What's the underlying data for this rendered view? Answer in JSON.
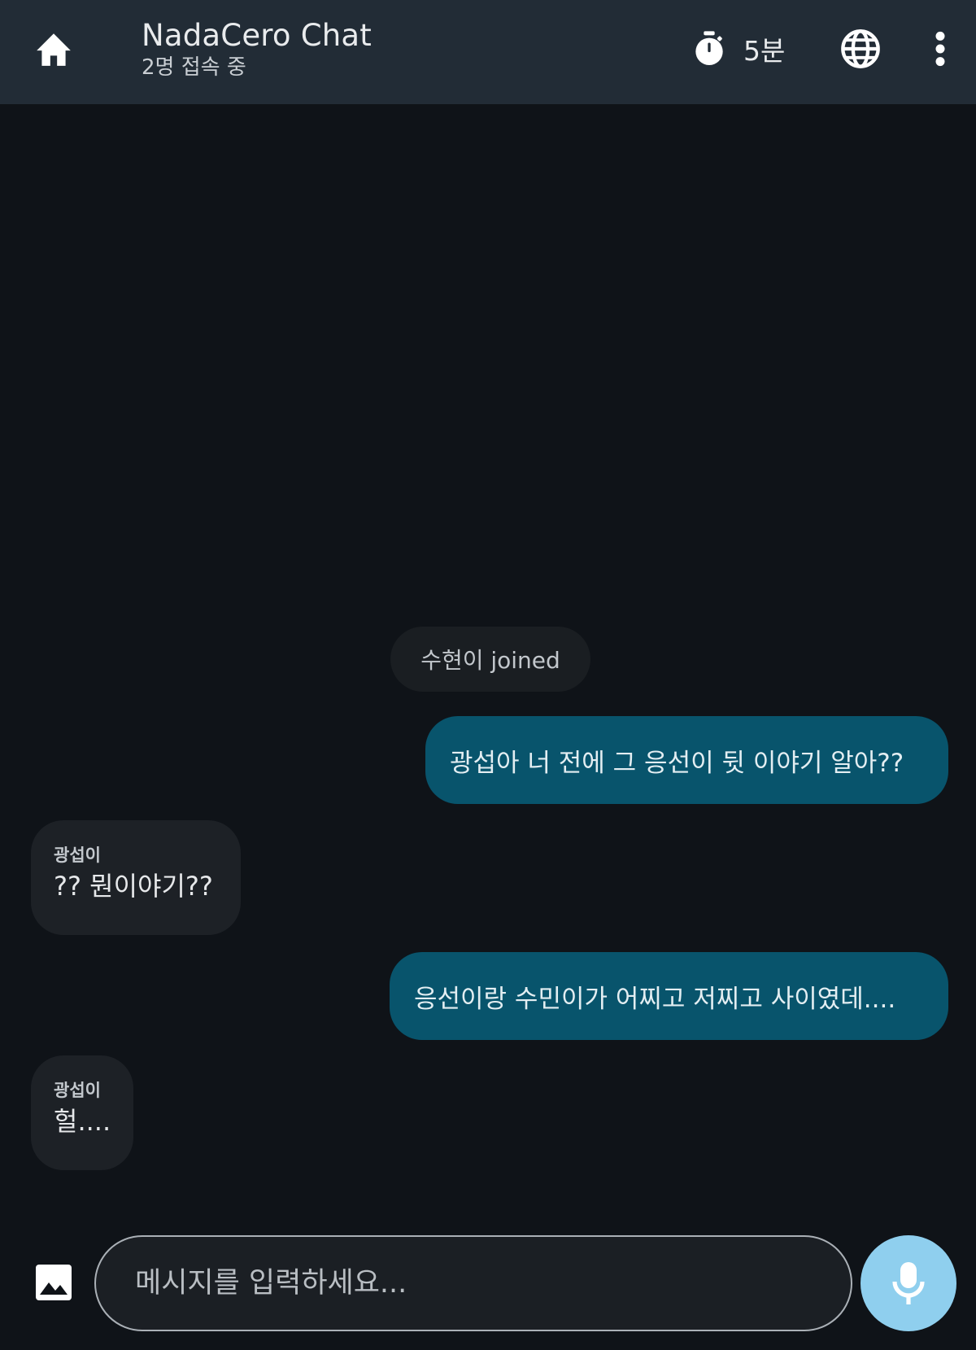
{
  "header": {
    "title": "NadaCero Chat",
    "subtitle": "2명 접속 중",
    "timer_label": "5분",
    "icons": {
      "home": "home-icon",
      "timer": "stopwatch-icon",
      "language": "globe-icon",
      "more": "more-vert-icon"
    }
  },
  "system": {
    "joined_text": "수현이 joined"
  },
  "messages": [
    {
      "direction": "out",
      "text": "광섭아 너 전에 그 응선이 뒷 이야기 알아??"
    },
    {
      "direction": "in",
      "sender": "광섭이",
      "text": "?? 뭔이야기??"
    },
    {
      "direction": "out",
      "text": "응선이랑 수민이가  어찌고 저찌고 사이였데...."
    },
    {
      "direction": "in",
      "sender": "광섭이",
      "text": "헐...."
    }
  ],
  "composer": {
    "placeholder": "메시지를 입력하세요...",
    "icons": {
      "image": "image-icon",
      "mic": "mic-icon"
    }
  },
  "colors": {
    "header_bg": "#222c36",
    "chat_bg": "#0f1318",
    "outgoing_bubble": "#08546c",
    "incoming_bubble": "#1d2126",
    "mic_button": "#8fcfee"
  }
}
